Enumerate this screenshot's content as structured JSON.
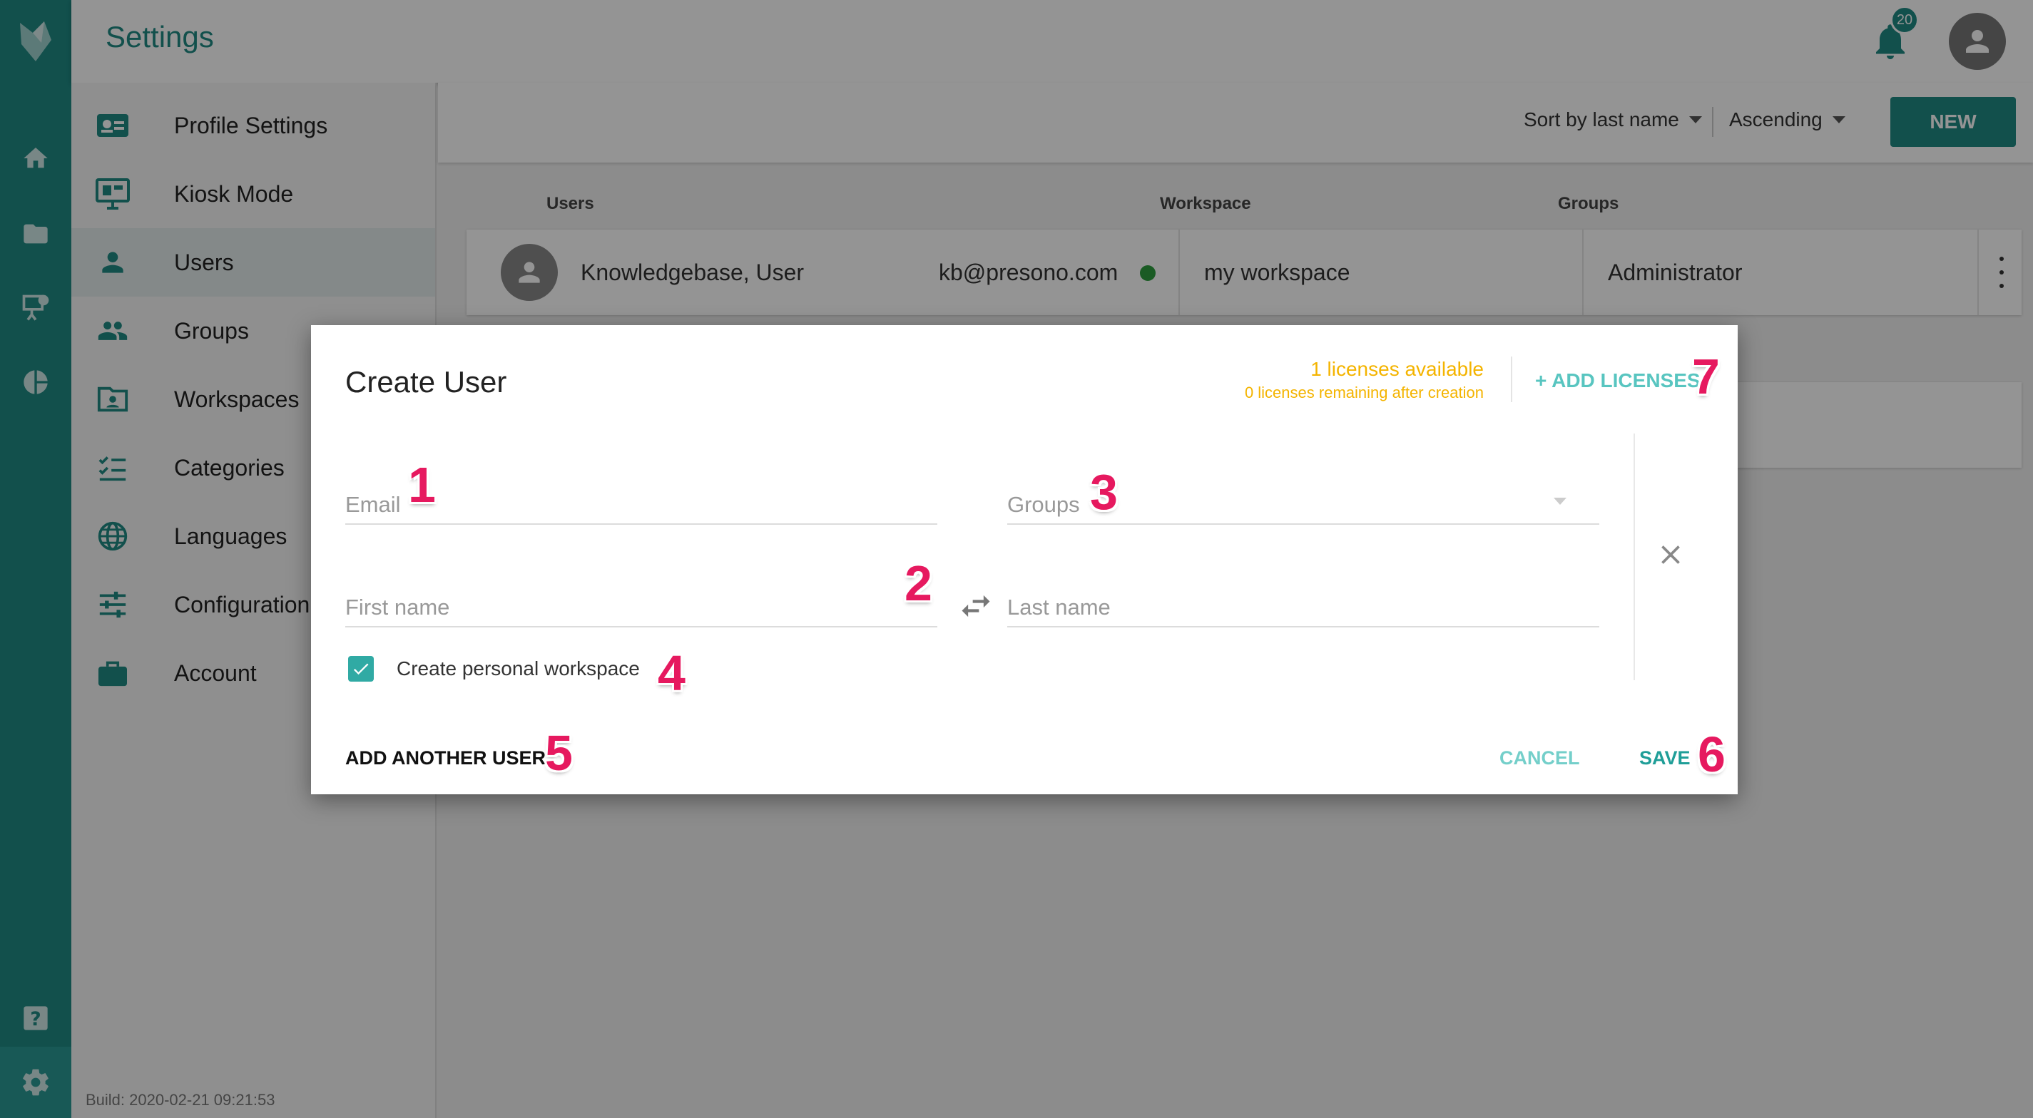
{
  "header": {
    "title": "Settings",
    "notification_count": "20"
  },
  "nav": {
    "items": [
      {
        "label": "Profile Settings",
        "icon": "profile-card-icon"
      },
      {
        "label": "Kiosk Mode",
        "icon": "monitor-icon"
      },
      {
        "label": "Users",
        "icon": "person-icon",
        "active": true
      },
      {
        "label": "Groups",
        "icon": "people-icon"
      },
      {
        "label": "Workspaces",
        "icon": "folder-person-icon"
      },
      {
        "label": "Categories",
        "icon": "checklist-icon"
      },
      {
        "label": "Languages",
        "icon": "globe-icon"
      },
      {
        "label": "Configuration",
        "icon": "sliders-icon"
      },
      {
        "label": "Account",
        "icon": "briefcase-icon"
      }
    ],
    "build": "Build: 2020-02-21 09:21:53"
  },
  "toolbar": {
    "sort_by": "Sort by last name",
    "order": "Ascending",
    "new_label": "NEW"
  },
  "table": {
    "headers": [
      "Users",
      "Workspace",
      "Groups"
    ],
    "rows": [
      {
        "name": "Knowledgebase, User",
        "email": "kb@presono.com",
        "workspace": "my workspace",
        "group": "Administrator"
      }
    ]
  },
  "dialog": {
    "title": "Create User",
    "licenses_available": "1 licenses available",
    "licenses_remaining": "0 licenses remaining after creation",
    "add_licenses": "+ ADD LICENSES",
    "email_placeholder": "Email",
    "groups_placeholder": "Groups",
    "first_name_placeholder": "First name",
    "last_name_placeholder": "Last name",
    "personal_workspace_label": "Create personal workspace",
    "personal_workspace_checked": true,
    "add_another_label": "ADD ANOTHER USER",
    "cancel_label": "CANCEL",
    "save_label": "SAVE"
  },
  "markers": [
    "1",
    "2",
    "3",
    "4",
    "5",
    "6",
    "7"
  ],
  "colors": {
    "brand": "#1f8a84",
    "accent": "#30aaa4",
    "license": "#f4b400",
    "marker": "#e6195f"
  }
}
